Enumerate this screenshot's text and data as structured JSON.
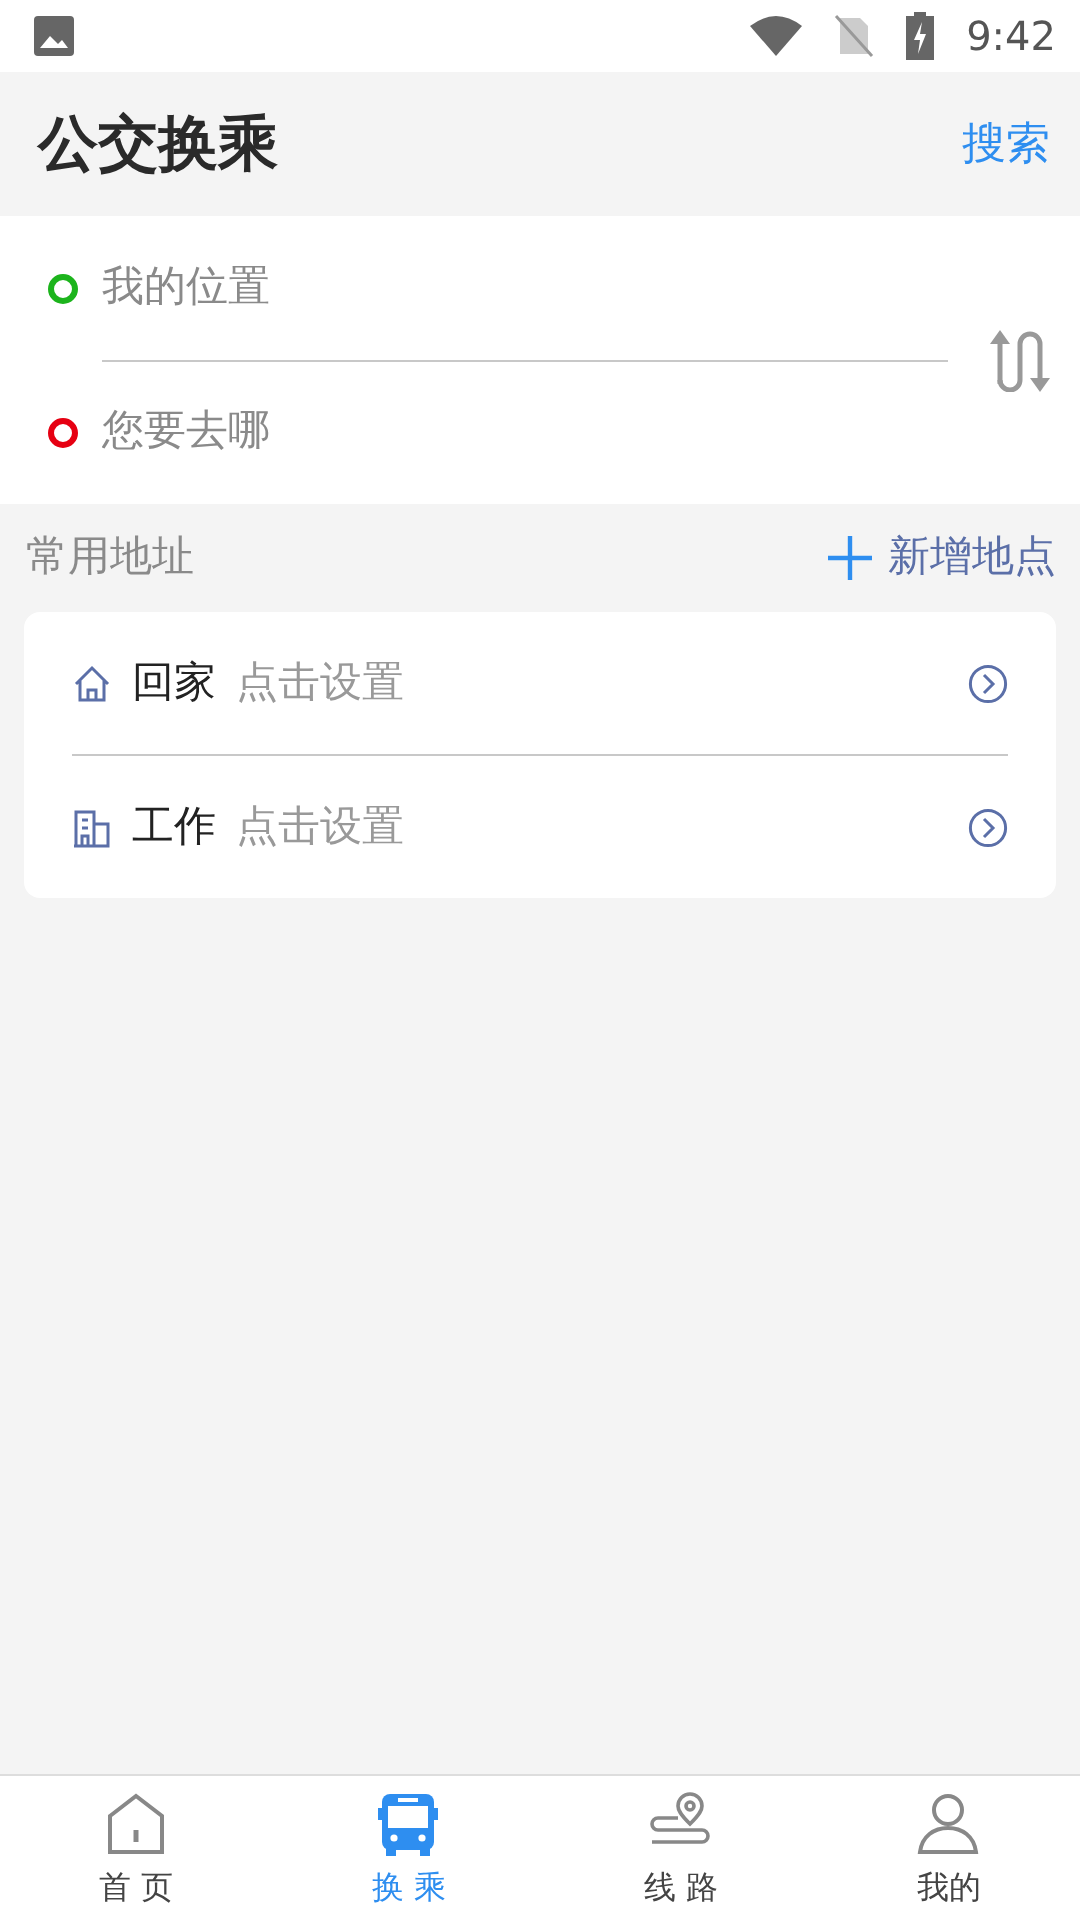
{
  "status_bar": {
    "time": "9:42"
  },
  "header": {
    "title": "公交换乘",
    "action": "搜索"
  },
  "route": {
    "points": [
      {
        "placeholder": "我的位置",
        "color": "#1cb41c"
      },
      {
        "placeholder": "您要去哪",
        "color": "#e60012"
      }
    ]
  },
  "favorites": {
    "title": "常用地址",
    "add_label": "新增地点",
    "items": [
      {
        "kind": "home",
        "name": "回家",
        "hint": "点击设置"
      },
      {
        "kind": "work",
        "name": "工作",
        "hint": "点击设置"
      }
    ]
  },
  "tabs": [
    {
      "kind": "home",
      "label": "首 页",
      "selected": false
    },
    {
      "kind": "bus",
      "label": "换 乘",
      "selected": true
    },
    {
      "kind": "route",
      "label": "线 路",
      "selected": false
    },
    {
      "kind": "person",
      "label": "我的",
      "selected": false
    }
  ]
}
